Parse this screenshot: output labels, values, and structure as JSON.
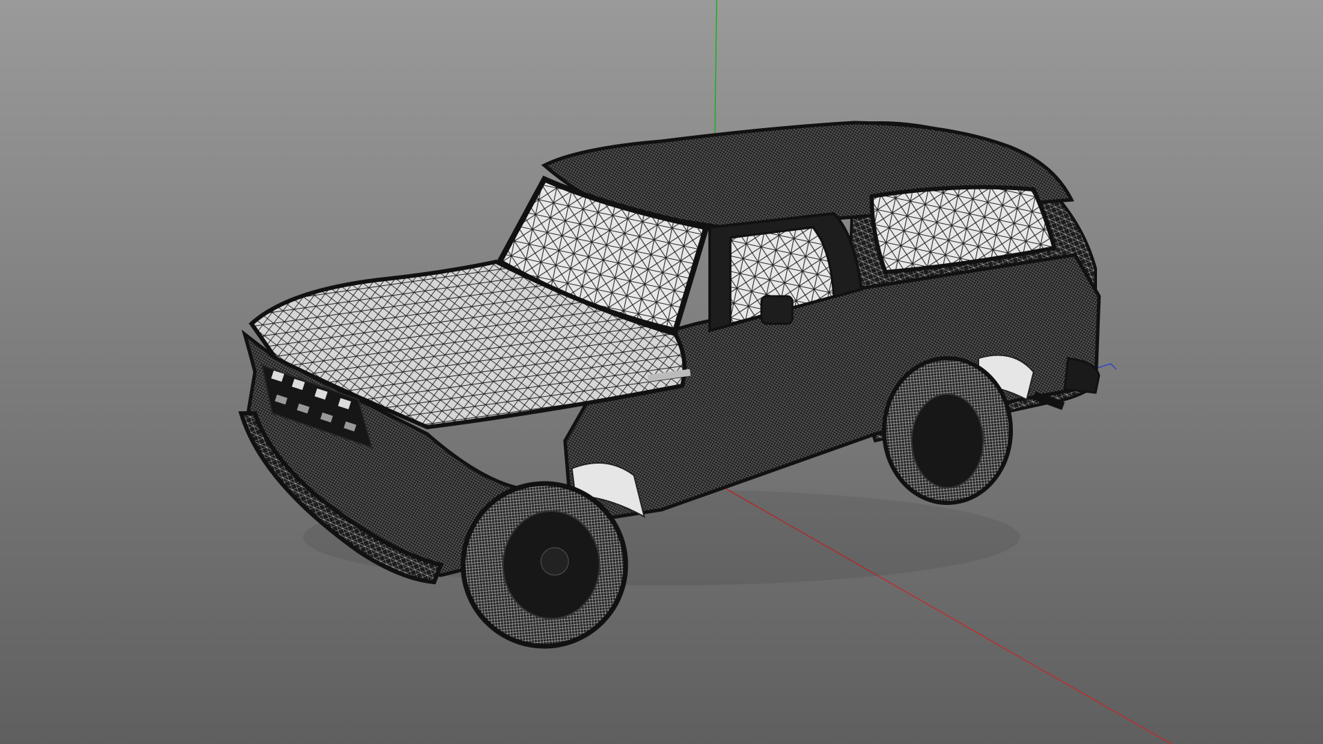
{
  "viewport": {
    "background_top": "#9a9a9a",
    "background_bottom": "#5f5f5f",
    "background_style": "vertical-gradient"
  },
  "scene": {
    "object": "pickup-truck-wireframe-mesh",
    "render_mode": "wireframe-on-shaded",
    "mesh_color": "#1c1c1c",
    "wire_color": "#ffffff"
  },
  "axes": {
    "x_axis_color": "#c62828",
    "y_axis_color": "#1fae2a",
    "z_axis_color": "#2a3fd1"
  }
}
